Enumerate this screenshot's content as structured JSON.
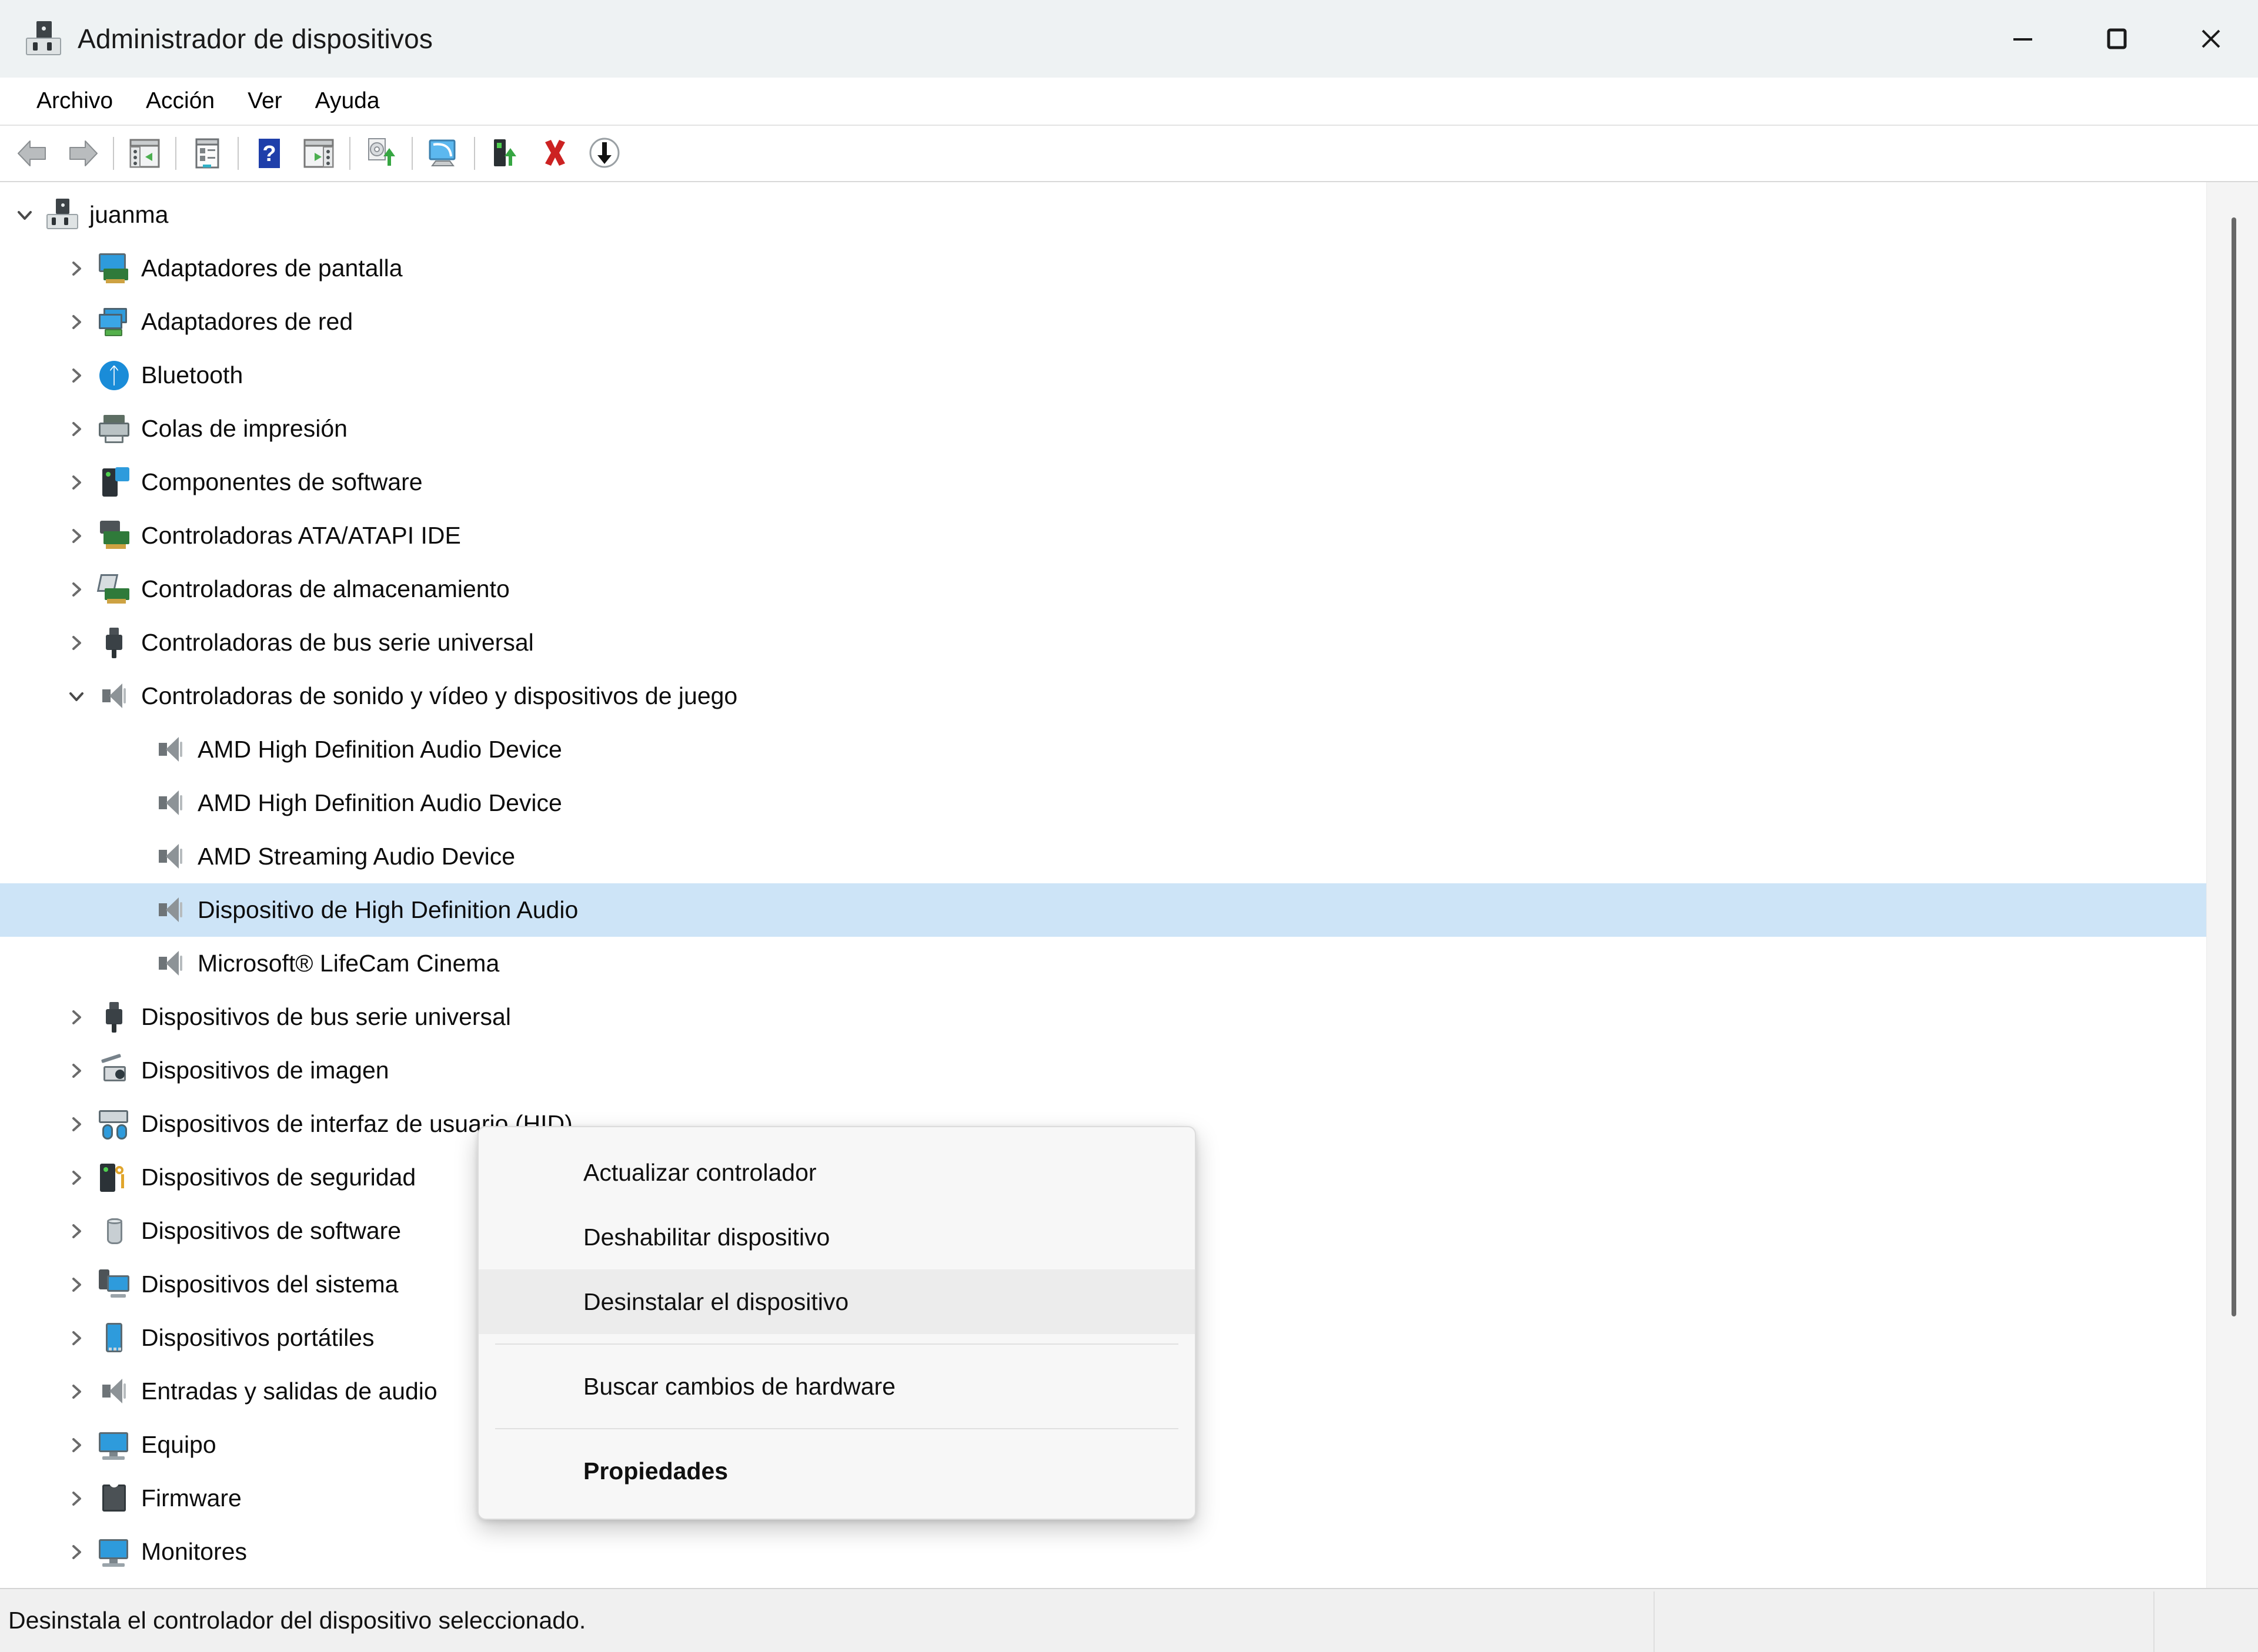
{
  "window": {
    "title": "Administrador de dispositivos",
    "icon": "device-manager-icon",
    "controls": {
      "minimize": "minimize-icon",
      "maximize": "maximize-icon",
      "close": "close-icon"
    }
  },
  "menubar": {
    "items": [
      {
        "label": "Archivo"
      },
      {
        "label": "Acción"
      },
      {
        "label": "Ver"
      },
      {
        "label": "Ayuda"
      }
    ]
  },
  "toolbar": {
    "buttons": [
      {
        "name": "back-button",
        "icon": "back-arrow-icon"
      },
      {
        "name": "forward-button",
        "icon": "forward-arrow-icon"
      },
      {
        "name": "separator-1",
        "icon": "separator"
      },
      {
        "name": "show-hide-console-tree-button",
        "icon": "console-tree-icon"
      },
      {
        "name": "separator-2",
        "icon": "separator"
      },
      {
        "name": "properties-button",
        "icon": "properties-icon"
      },
      {
        "name": "separator-3",
        "icon": "separator"
      },
      {
        "name": "help-button",
        "icon": "help-question-icon"
      },
      {
        "name": "show-hide-action-pane-button",
        "icon": "action-pane-icon"
      },
      {
        "name": "separator-4",
        "icon": "separator"
      },
      {
        "name": "update-driver-button",
        "icon": "update-driver-icon"
      },
      {
        "name": "separator-5",
        "icon": "separator"
      },
      {
        "name": "scan-hardware-changes-button",
        "icon": "scan-hardware-icon"
      },
      {
        "name": "separator-6",
        "icon": "separator"
      },
      {
        "name": "enable-device-button",
        "icon": "enable-device-icon"
      },
      {
        "name": "uninstall-device-button",
        "icon": "red-x-icon"
      },
      {
        "name": "disable-device-button",
        "icon": "down-arrow-circle-icon"
      }
    ]
  },
  "tree": {
    "nodes": [
      {
        "label": "juanma",
        "level": 0,
        "expander": "expanded",
        "icon": "computer-icon",
        "selected": false
      },
      {
        "label": "Adaptadores de pantalla",
        "level": 1,
        "expander": "collapsed",
        "icon": "display-adapter-icon",
        "selected": false
      },
      {
        "label": "Adaptadores de red",
        "level": 1,
        "expander": "collapsed",
        "icon": "network-adapter-icon",
        "selected": false
      },
      {
        "label": "Bluetooth",
        "level": 1,
        "expander": "collapsed",
        "icon": "bluetooth-icon",
        "selected": false
      },
      {
        "label": "Colas de impresión",
        "level": 1,
        "expander": "collapsed",
        "icon": "printer-icon",
        "selected": false
      },
      {
        "label": "Componentes de software",
        "level": 1,
        "expander": "collapsed",
        "icon": "software-component-icon",
        "selected": false
      },
      {
        "label": "Controladoras ATA/ATAPI IDE",
        "level": 1,
        "expander": "collapsed",
        "icon": "ide-controller-icon",
        "selected": false
      },
      {
        "label": "Controladoras de almacenamiento",
        "level": 1,
        "expander": "collapsed",
        "icon": "storage-controller-icon",
        "selected": false
      },
      {
        "label": "Controladoras de bus serie universal",
        "level": 1,
        "expander": "collapsed",
        "icon": "usb-icon",
        "selected": false
      },
      {
        "label": "Controladoras de sonido y vídeo y dispositivos de juego",
        "level": 1,
        "expander": "expanded",
        "icon": "speaker-icon",
        "selected": false
      },
      {
        "label": "AMD High Definition Audio Device",
        "level": 2,
        "expander": "none",
        "icon": "speaker-icon",
        "selected": false
      },
      {
        "label": "AMD High Definition Audio Device",
        "level": 2,
        "expander": "none",
        "icon": "speaker-icon",
        "selected": false
      },
      {
        "label": "AMD Streaming Audio Device",
        "level": 2,
        "expander": "none",
        "icon": "speaker-icon",
        "selected": false
      },
      {
        "label": "Dispositivo de High Definition Audio",
        "level": 2,
        "expander": "none",
        "icon": "speaker-icon",
        "selected": true
      },
      {
        "label": "Microsoft® LifeCam Cinema",
        "level": 2,
        "expander": "none",
        "icon": "speaker-icon",
        "selected": false
      },
      {
        "label": "Dispositivos de bus serie universal",
        "level": 1,
        "expander": "collapsed",
        "icon": "usb-icon",
        "selected": false
      },
      {
        "label": "Dispositivos de imagen",
        "level": 1,
        "expander": "collapsed",
        "icon": "imaging-device-icon",
        "selected": false
      },
      {
        "label": "Dispositivos de interfaz de usuario (HID)",
        "level": 1,
        "expander": "collapsed",
        "icon": "hid-icon",
        "selected": false
      },
      {
        "label": "Dispositivos de seguridad",
        "level": 1,
        "expander": "collapsed",
        "icon": "security-device-icon",
        "selected": false
      },
      {
        "label": "Dispositivos de software",
        "level": 1,
        "expander": "collapsed",
        "icon": "software-device-icon",
        "selected": false
      },
      {
        "label": "Dispositivos del sistema",
        "level": 1,
        "expander": "collapsed",
        "icon": "system-device-icon",
        "selected": false
      },
      {
        "label": "Dispositivos portátiles",
        "level": 1,
        "expander": "collapsed",
        "icon": "portable-device-icon",
        "selected": false
      },
      {
        "label": "Entradas y salidas de audio",
        "level": 1,
        "expander": "collapsed",
        "icon": "speaker-icon",
        "selected": false
      },
      {
        "label": "Equipo",
        "level": 1,
        "expander": "collapsed",
        "icon": "monitor-icon",
        "selected": false
      },
      {
        "label": "Firmware",
        "level": 1,
        "expander": "collapsed",
        "icon": "firmware-chip-icon",
        "selected": false
      },
      {
        "label": "Monitores",
        "level": 1,
        "expander": "collapsed",
        "icon": "monitor-icon",
        "selected": false
      }
    ]
  },
  "context_menu": {
    "items": [
      {
        "label": "Actualizar controlador",
        "highlighted": false,
        "bold": false,
        "separator_after": false
      },
      {
        "label": "Deshabilitar dispositivo",
        "highlighted": false,
        "bold": false,
        "separator_after": false
      },
      {
        "label": "Desinstalar el dispositivo",
        "highlighted": true,
        "bold": false,
        "separator_after": true
      },
      {
        "label": "Buscar cambios de hardware",
        "highlighted": false,
        "bold": false,
        "separator_after": true
      },
      {
        "label": "Propiedades",
        "highlighted": false,
        "bold": true,
        "separator_after": false
      }
    ]
  },
  "statusbar": {
    "text": "Desinstala el controlador del dispositivo seleccionado."
  },
  "colors": {
    "titlebar_bg": "#eef2f3",
    "selection_bg": "#cde4f7",
    "menu_highlight": "#ececec",
    "status_bg": "#f0f0f0",
    "accent_blue": "#2e9bdc",
    "red_x": "#cc2222",
    "green": "#2f7a3a"
  }
}
